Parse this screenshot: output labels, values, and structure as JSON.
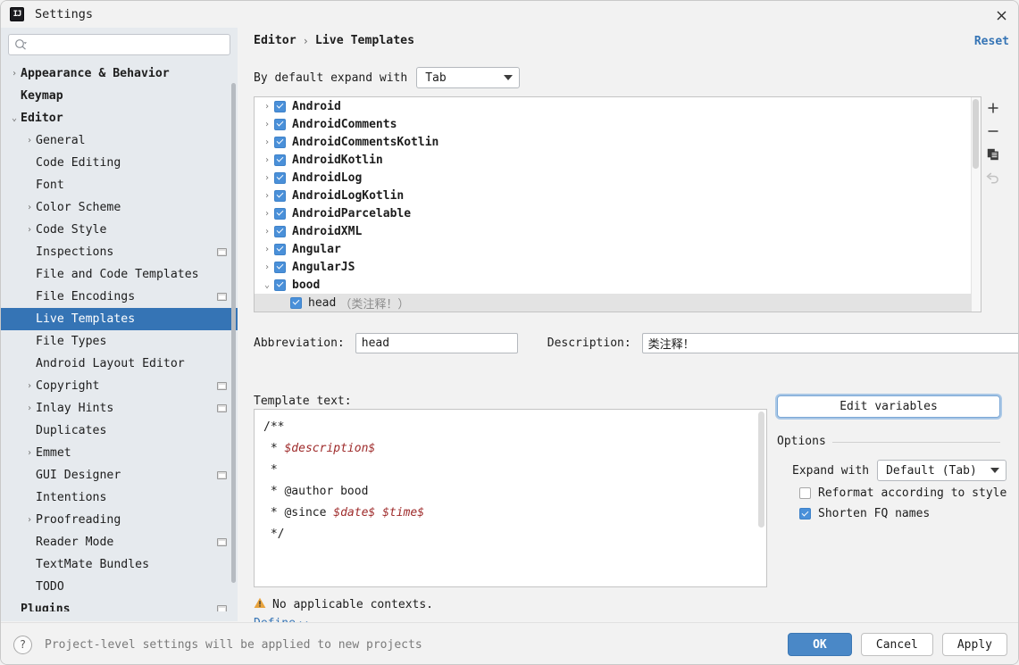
{
  "window": {
    "title": "Settings",
    "app_icon": "intellij-idea-icon",
    "close_icon": "close-icon"
  },
  "sidebar": {
    "search": {
      "placeholder": "",
      "value": "",
      "icon": "search-icon"
    },
    "items": [
      {
        "label": "Appearance & Behavior",
        "level": 0,
        "arrow": "›",
        "bold": true,
        "selected": false,
        "badge": false
      },
      {
        "label": "Keymap",
        "level": 0,
        "arrow": "",
        "bold": true,
        "selected": false,
        "badge": false
      },
      {
        "label": "Editor",
        "level": 0,
        "arrow": "⌄",
        "bold": true,
        "selected": false,
        "badge": false
      },
      {
        "label": "General",
        "level": 1,
        "arrow": "›",
        "bold": false,
        "selected": false,
        "badge": false
      },
      {
        "label": "Code Editing",
        "level": 1,
        "arrow": "",
        "bold": false,
        "selected": false,
        "badge": false
      },
      {
        "label": "Font",
        "level": 1,
        "arrow": "",
        "bold": false,
        "selected": false,
        "badge": false
      },
      {
        "label": "Color Scheme",
        "level": 1,
        "arrow": "›",
        "bold": false,
        "selected": false,
        "badge": false
      },
      {
        "label": "Code Style",
        "level": 1,
        "arrow": "›",
        "bold": false,
        "selected": false,
        "badge": false
      },
      {
        "label": "Inspections",
        "level": 1,
        "arrow": "",
        "bold": false,
        "selected": false,
        "badge": true
      },
      {
        "label": "File and Code Templates",
        "level": 1,
        "arrow": "",
        "bold": false,
        "selected": false,
        "badge": false
      },
      {
        "label": "File Encodings",
        "level": 1,
        "arrow": "",
        "bold": false,
        "selected": false,
        "badge": true
      },
      {
        "label": "Live Templates",
        "level": 1,
        "arrow": "",
        "bold": false,
        "selected": true,
        "badge": false
      },
      {
        "label": "File Types",
        "level": 1,
        "arrow": "",
        "bold": false,
        "selected": false,
        "badge": false
      },
      {
        "label": "Android Layout Editor",
        "level": 1,
        "arrow": "",
        "bold": false,
        "selected": false,
        "badge": false
      },
      {
        "label": "Copyright",
        "level": 1,
        "arrow": "›",
        "bold": false,
        "selected": false,
        "badge": true
      },
      {
        "label": "Inlay Hints",
        "level": 1,
        "arrow": "›",
        "bold": false,
        "selected": false,
        "badge": true
      },
      {
        "label": "Duplicates",
        "level": 1,
        "arrow": "",
        "bold": false,
        "selected": false,
        "badge": false
      },
      {
        "label": "Emmet",
        "level": 1,
        "arrow": "›",
        "bold": false,
        "selected": false,
        "badge": false
      },
      {
        "label": "GUI Designer",
        "level": 1,
        "arrow": "",
        "bold": false,
        "selected": false,
        "badge": true
      },
      {
        "label": "Intentions",
        "level": 1,
        "arrow": "",
        "bold": false,
        "selected": false,
        "badge": false
      },
      {
        "label": "Proofreading",
        "level": 1,
        "arrow": "›",
        "bold": false,
        "selected": false,
        "badge": false
      },
      {
        "label": "Reader Mode",
        "level": 1,
        "arrow": "",
        "bold": false,
        "selected": false,
        "badge": true
      },
      {
        "label": "TextMate Bundles",
        "level": 1,
        "arrow": "",
        "bold": false,
        "selected": false,
        "badge": false
      },
      {
        "label": "TODO",
        "level": 1,
        "arrow": "",
        "bold": false,
        "selected": false,
        "badge": false
      },
      {
        "label": "Plugins",
        "level": 0,
        "arrow": "",
        "bold": true,
        "selected": false,
        "badge": true
      }
    ]
  },
  "main": {
    "breadcrumb": {
      "parent": "Editor",
      "separator": "›",
      "current": "Live Templates"
    },
    "reset_label": "Reset",
    "expand_with": {
      "label": "By default expand with",
      "value": "Tab",
      "caret_icon": "chevron-down-icon"
    },
    "toolbar": {
      "add_icon": "plus-icon",
      "remove_icon": "minus-icon",
      "duplicate_icon": "copy-icon",
      "revert_icon": "undo-icon"
    },
    "templates": [
      {
        "name": "Android",
        "arrow": "›",
        "checked": true,
        "child": false,
        "selected": false,
        "desc": ""
      },
      {
        "name": "AndroidComments",
        "arrow": "›",
        "checked": true,
        "child": false,
        "selected": false,
        "desc": ""
      },
      {
        "name": "AndroidCommentsKotlin",
        "arrow": "›",
        "checked": true,
        "child": false,
        "selected": false,
        "desc": ""
      },
      {
        "name": "AndroidKotlin",
        "arrow": "›",
        "checked": true,
        "child": false,
        "selected": false,
        "desc": ""
      },
      {
        "name": "AndroidLog",
        "arrow": "›",
        "checked": true,
        "child": false,
        "selected": false,
        "desc": ""
      },
      {
        "name": "AndroidLogKotlin",
        "arrow": "›",
        "checked": true,
        "child": false,
        "selected": false,
        "desc": ""
      },
      {
        "name": "AndroidParcelable",
        "arrow": "›",
        "checked": true,
        "child": false,
        "selected": false,
        "desc": ""
      },
      {
        "name": "AndroidXML",
        "arrow": "›",
        "checked": true,
        "child": false,
        "selected": false,
        "desc": ""
      },
      {
        "name": "Angular",
        "arrow": "›",
        "checked": true,
        "child": false,
        "selected": false,
        "desc": ""
      },
      {
        "name": "AngularJS",
        "arrow": "›",
        "checked": true,
        "child": false,
        "selected": false,
        "desc": ""
      },
      {
        "name": "bood",
        "arrow": "⌄",
        "checked": true,
        "child": false,
        "selected": false,
        "desc": ""
      },
      {
        "name": "head",
        "arrow": "",
        "checked": true,
        "child": true,
        "selected": true,
        "desc": "（类注释！）"
      }
    ],
    "abbreviation": {
      "label": "Abbreviation:",
      "value": "head"
    },
    "description": {
      "label": "Description:",
      "value": "类注释！"
    },
    "template_text": {
      "label": "Template text:",
      "lines": [
        [
          {
            "t": "/**",
            "v": false
          }
        ],
        [
          {
            "t": " * ",
            "v": false
          },
          {
            "t": "$description$",
            "v": true
          }
        ],
        [
          {
            "t": " *",
            "v": false
          }
        ],
        [
          {
            "t": " * @author bood",
            "v": false
          }
        ],
        [
          {
            "t": " * @since ",
            "v": false
          },
          {
            "t": "$date$ $time$",
            "v": true
          }
        ],
        [
          {
            "t": " */",
            "v": false
          }
        ]
      ]
    },
    "edit_variables_label": "Edit variables",
    "options": {
      "title": "Options",
      "expand_with_label": "Expand with",
      "expand_with_value": "Default (Tab)",
      "reformat": {
        "label": "Reformat according to style",
        "checked": false
      },
      "shorten": {
        "label": "Shorten FQ names",
        "checked": true
      }
    },
    "context_warning": {
      "icon": "warning-icon",
      "text": "No applicable contexts."
    },
    "define_link": {
      "text": "Define",
      "caret_icon": "chevron-down-icon"
    }
  },
  "footer": {
    "help_icon": "help-icon",
    "note": "Project-level settings will be applied to new projects",
    "ok": "OK",
    "cancel": "Cancel",
    "apply": "Apply"
  },
  "colors": {
    "accent_blue": "#3574b5",
    "primary_button": "#4a88c7",
    "link": "#3574b5",
    "selection_row": "#e3e3e3",
    "sidebar_bg": "#e6eaee",
    "panel_bg": "#f2f2f2",
    "template_var": "#9e2a2a",
    "warning": "#e8a33d"
  }
}
